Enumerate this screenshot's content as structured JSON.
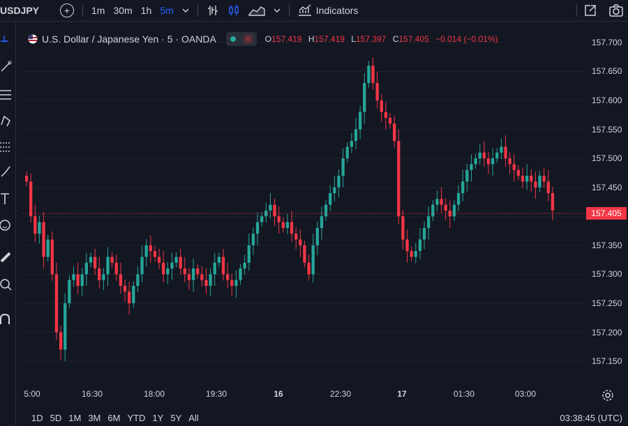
{
  "topbar": {
    "symbol": "USDJPY",
    "intervals": [
      {
        "label": "1m",
        "active": false
      },
      {
        "label": "30m",
        "active": false
      },
      {
        "label": "1h",
        "active": false
      },
      {
        "label": "5m",
        "active": true
      }
    ],
    "indicators_label": "Indicators"
  },
  "legend": {
    "title": "U.S. Dollar / Japanese Yen · 5 · OANDA",
    "open_key": "O",
    "open": "157.419",
    "high_key": "H",
    "high": "157.419",
    "low_key": "L",
    "low": "157.397",
    "close_key": "C",
    "close": "157.405",
    "change": "−0.014 (−0.01%)"
  },
  "price_axis": {
    "labels": [
      "157.700",
      "157.650",
      "157.600",
      "157.550",
      "157.500",
      "157.450",
      "157.400",
      "157.350",
      "157.300",
      "157.250",
      "157.200",
      "157.150"
    ],
    "last_price": "157.405"
  },
  "time_axis": {
    "labels": [
      {
        "text": "5:00",
        "bold": false
      },
      {
        "text": "16:30",
        "bold": false
      },
      {
        "text": "18:00",
        "bold": false
      },
      {
        "text": "19:30",
        "bold": false
      },
      {
        "text": "16",
        "bold": true
      },
      {
        "text": "22:30",
        "bold": false
      },
      {
        "text": "17",
        "bold": true
      },
      {
        "text": "01:30",
        "bold": false
      },
      {
        "text": "03:00",
        "bold": false
      }
    ]
  },
  "bottombar": {
    "ranges": [
      "1D",
      "5D",
      "1M",
      "3M",
      "6M",
      "YTD",
      "1Y",
      "5Y",
      "All"
    ],
    "clock": "03:38:45 (UTC)"
  },
  "colors": {
    "up": "#26a69a",
    "down": "#f23645",
    "grid": "#1e222d",
    "bg": "#131722"
  },
  "chart_data": {
    "type": "candlestick",
    "ylim": [
      157.12,
      157.73
    ],
    "close_series": [
      157.46,
      157.4,
      157.37,
      157.39,
      157.33,
      157.36,
      157.3,
      157.2,
      157.17,
      157.25,
      157.29,
      157.3,
      157.28,
      157.3,
      157.32,
      157.33,
      157.31,
      157.29,
      157.3,
      157.33,
      157.32,
      157.3,
      157.28,
      157.27,
      157.25,
      157.28,
      157.3,
      157.33,
      157.35,
      157.34,
      157.33,
      157.32,
      157.3,
      157.31,
      157.32,
      157.33,
      157.31,
      157.3,
      157.29,
      157.31,
      157.3,
      157.29,
      157.28,
      157.3,
      157.32,
      157.33,
      157.3,
      157.29,
      157.28,
      157.29,
      157.31,
      157.32,
      157.35,
      157.37,
      157.39,
      157.4,
      157.41,
      157.42,
      157.4,
      157.39,
      157.38,
      157.39,
      157.37,
      157.36,
      157.35,
      157.32,
      157.3,
      157.35,
      157.38,
      157.4,
      157.42,
      157.44,
      157.45,
      157.47,
      157.5,
      157.52,
      157.53,
      157.55,
      157.58,
      157.63,
      157.66,
      157.63,
      157.6,
      157.58,
      157.57,
      157.56,
      157.53,
      157.4,
      157.36,
      157.34,
      157.33,
      157.34,
      157.36,
      157.38,
      157.4,
      157.42,
      157.43,
      157.42,
      157.41,
      157.4,
      157.42,
      157.44,
      157.46,
      157.48,
      157.49,
      157.5,
      157.51,
      157.5,
      157.49,
      157.5,
      157.51,
      157.52,
      157.5,
      157.49,
      157.48,
      157.47,
      157.46,
      157.47,
      157.46,
      157.45,
      157.47,
      157.46,
      157.44,
      157.41
    ]
  }
}
